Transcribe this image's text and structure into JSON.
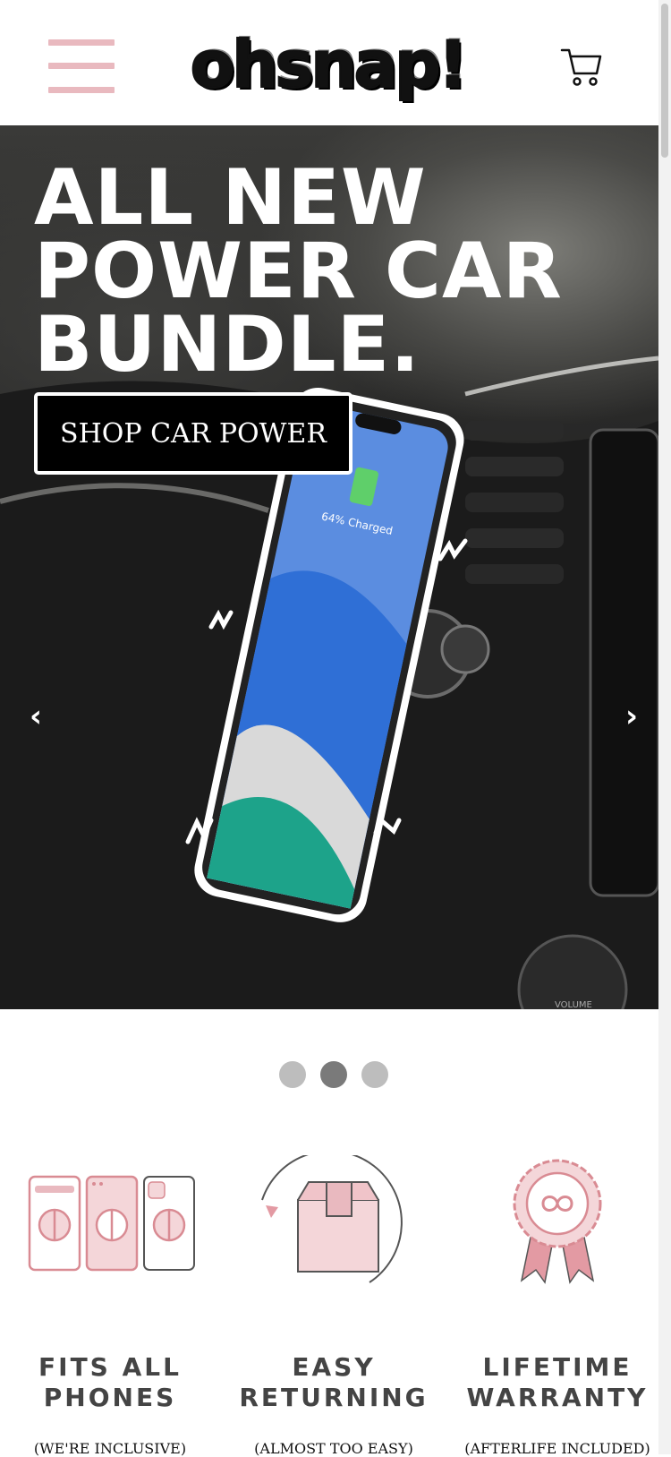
{
  "header": {
    "logo_text": "ohsnap!",
    "menu_icon": "hamburger-menu-icon",
    "cart_icon": "shopping-cart-icon"
  },
  "hero": {
    "title_lines": [
      "ALL NEW",
      "POWER CAR",
      "BUNDLE."
    ],
    "button_label": "SHOP CAR POWER",
    "phone_screen_text": "64% Charged",
    "prev_arrow": "‹",
    "next_arrow": "›",
    "dash_label": "VOLUME"
  },
  "carousel": {
    "dot_count": 3,
    "active_index": 1
  },
  "features": [
    {
      "title_line1": "FITS ALL",
      "title_line2": "PHONES",
      "subtitle": "(WE'RE INCLUSIVE)",
      "icon": "phones-grip-icon"
    },
    {
      "title_line1": "EASY",
      "title_line2": "RETURNING",
      "subtitle": "(ALMOST TOO EASY)",
      "icon": "return-box-icon"
    },
    {
      "title_line1": "LIFETIME",
      "title_line2": "WARRANTY",
      "subtitle": "(AFTERLIFE INCLUDED)",
      "icon": "warranty-ribbon-icon"
    }
  ],
  "colors": {
    "accent_pink": "#e9b9bf",
    "icon_pink": "#d98b93",
    "dot_inactive": "#bdbdbd",
    "dot_active": "#7a7a7a"
  }
}
